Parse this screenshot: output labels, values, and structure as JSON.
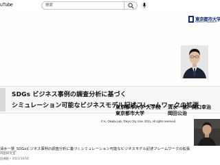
{
  "topbar": {
    "logo_text": "uTube",
    "search_placeholder": "検索",
    "search_icon": "search-icon",
    "mic_icon": "microphone-icon"
  },
  "slide": {
    "university_name": "東京都市大学",
    "university_sub": "TOKYO CITY UNIVERSITY",
    "title_line1": "SDGs ビジネス事例の調査分析に基づく",
    "title_line2": "シミュレーション可能なビジネスモデル記述フレームワークの拡張",
    "affiliation1": "東京都市大学 大学院",
    "authors1": "清水一慧、関口幸治",
    "affiliation2": "東京都市大学",
    "authors2": "岡田公治",
    "copyright": "© K. Okada Lab, Tokyo City Univ. 2021, All rights reserved.",
    "colors": {
      "university_blue": "#0c2f78",
      "title_band": "#f7f7f7"
    }
  },
  "video_info": {
    "title": "清水一慧_SDGsビジネス事例の調査分析に基づくシミュレーション可能なビジネスモデル記述フレームワークの拡張",
    "channel": "岡田研究室",
    "meta": "回視聴 • 2021/10/16"
  }
}
